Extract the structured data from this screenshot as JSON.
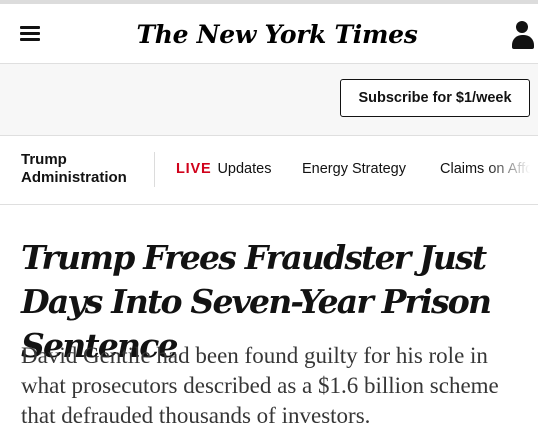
{
  "header": {
    "logo_text": "The New York Times",
    "menu_icon": "hamburger-menu-icon",
    "account_icon": "user-account-icon"
  },
  "subscribe": {
    "label": "Subscribe for $1/week"
  },
  "section_nav": {
    "section_title": "Trump Administration",
    "live_label": "LIVE",
    "items": [
      "Updates",
      "Energy Strategy",
      "Claims on Affo"
    ],
    "live_color": "#d0021b"
  },
  "article": {
    "headline": "Trump Frees Fraudster Just Days Into Seven-Year Prison Sentence",
    "summary": "David Gentile had been found guilty for his role in what prosecutors described as a $1.6 billion scheme that defrauded thousands of investors."
  }
}
